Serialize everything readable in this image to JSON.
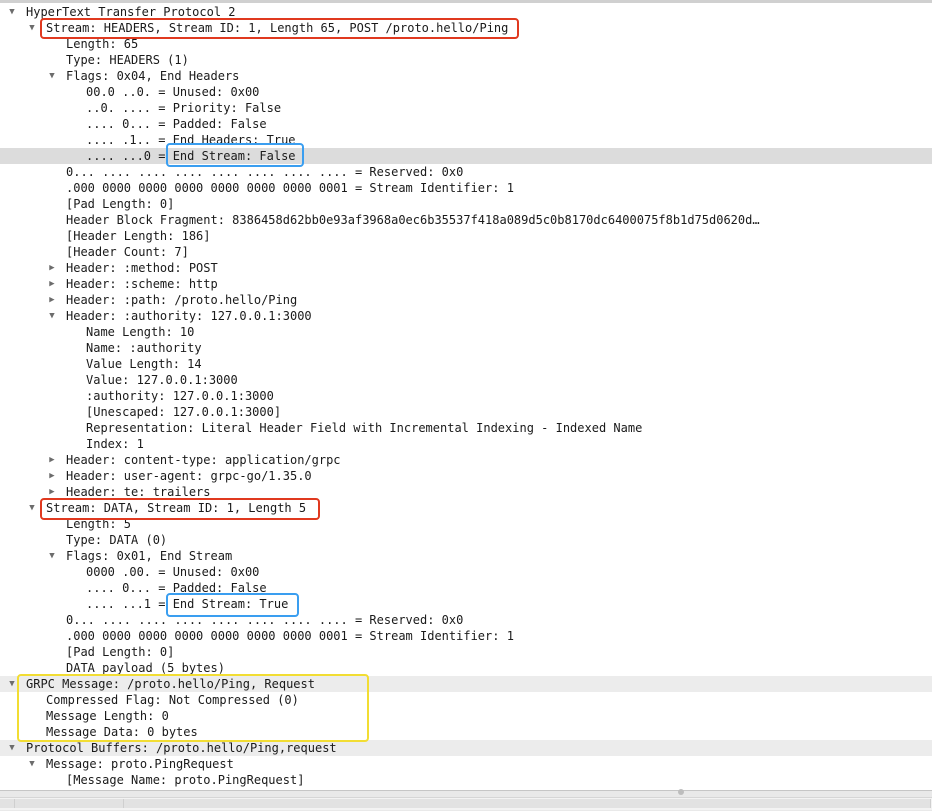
{
  "tree": [
    {
      "depth": 0,
      "toggle": "expanded",
      "text": "HyperText Transfer Protocol 2"
    },
    {
      "depth": 1,
      "toggle": "expanded",
      "text": "Stream: HEADERS, Stream ID: 1, Length 65, POST /proto.hello/Ping"
    },
    {
      "depth": 2,
      "toggle": "none",
      "text": "Length: 65"
    },
    {
      "depth": 2,
      "toggle": "none",
      "text": "Type: HEADERS (1)"
    },
    {
      "depth": 2,
      "toggle": "expanded",
      "text": "Flags: 0x04, End Headers"
    },
    {
      "depth": 3,
      "toggle": "none",
      "text": "00.0 ..0. = Unused: 0x00"
    },
    {
      "depth": 3,
      "toggle": "none",
      "text": "..0. .... = Priority: False"
    },
    {
      "depth": 3,
      "toggle": "none",
      "text": ".... 0... = Padded: False"
    },
    {
      "depth": 3,
      "toggle": "none",
      "text": ".... .1.. = End Headers: True"
    },
    {
      "depth": 3,
      "toggle": "none",
      "text": ".... ...0 = End Stream: False",
      "selected": true
    },
    {
      "depth": 2,
      "toggle": "none",
      "text": "0... .... .... .... .... .... .... .... = Reserved: 0x0"
    },
    {
      "depth": 2,
      "toggle": "none",
      "text": ".000 0000 0000 0000 0000 0000 0000 0001 = Stream Identifier: 1"
    },
    {
      "depth": 2,
      "toggle": "none",
      "text": "[Pad Length: 0]"
    },
    {
      "depth": 2,
      "toggle": "none",
      "text": "Header Block Fragment: 8386458d62bb0e93af3968a0ec6b35537f418a089d5c0b8170dc6400075f8b1d75d0620d…"
    },
    {
      "depth": 2,
      "toggle": "none",
      "text": "[Header Length: 186]"
    },
    {
      "depth": 2,
      "toggle": "none",
      "text": "[Header Count: 7]"
    },
    {
      "depth": 2,
      "toggle": "collapsed",
      "text": "Header: :method: POST"
    },
    {
      "depth": 2,
      "toggle": "collapsed",
      "text": "Header: :scheme: http"
    },
    {
      "depth": 2,
      "toggle": "collapsed",
      "text": "Header: :path: /proto.hello/Ping"
    },
    {
      "depth": 2,
      "toggle": "expanded",
      "text": "Header: :authority: 127.0.0.1:3000"
    },
    {
      "depth": 3,
      "toggle": "none",
      "text": "Name Length: 10"
    },
    {
      "depth": 3,
      "toggle": "none",
      "text": "Name: :authority"
    },
    {
      "depth": 3,
      "toggle": "none",
      "text": "Value Length: 14"
    },
    {
      "depth": 3,
      "toggle": "none",
      "text": "Value: 127.0.0.1:3000"
    },
    {
      "depth": 3,
      "toggle": "none",
      "text": ":authority: 127.0.0.1:3000"
    },
    {
      "depth": 3,
      "toggle": "none",
      "text": "[Unescaped: 127.0.0.1:3000]"
    },
    {
      "depth": 3,
      "toggle": "none",
      "text": "Representation: Literal Header Field with Incremental Indexing - Indexed Name"
    },
    {
      "depth": 3,
      "toggle": "none",
      "text": "Index: 1"
    },
    {
      "depth": 2,
      "toggle": "collapsed",
      "text": "Header: content-type: application/grpc"
    },
    {
      "depth": 2,
      "toggle": "collapsed",
      "text": "Header: user-agent: grpc-go/1.35.0"
    },
    {
      "depth": 2,
      "toggle": "collapsed",
      "text": "Header: te: trailers"
    },
    {
      "depth": 1,
      "toggle": "expanded",
      "text": "Stream: DATA, Stream ID: 1, Length 5"
    },
    {
      "depth": 2,
      "toggle": "none",
      "text": "Length: 5"
    },
    {
      "depth": 2,
      "toggle": "none",
      "text": "Type: DATA (0)"
    },
    {
      "depth": 2,
      "toggle": "expanded",
      "text": "Flags: 0x01, End Stream"
    },
    {
      "depth": 3,
      "toggle": "none",
      "text": "0000 .00. = Unused: 0x00"
    },
    {
      "depth": 3,
      "toggle": "none",
      "text": ".... 0... = Padded: False"
    },
    {
      "depth": 3,
      "toggle": "none",
      "text": ".... ...1 = End Stream: True"
    },
    {
      "depth": 2,
      "toggle": "none",
      "text": "0... .... .... .... .... .... .... .... = Reserved: 0x0"
    },
    {
      "depth": 2,
      "toggle": "none",
      "text": ".000 0000 0000 0000 0000 0000 0000 0001 = Stream Identifier: 1"
    },
    {
      "depth": 2,
      "toggle": "none",
      "text": "[Pad Length: 0]"
    },
    {
      "depth": 2,
      "toggle": "none",
      "text": "DATA payload (5 bytes)"
    },
    {
      "depth": 0,
      "toggle": "expanded",
      "text": "GRPC Message: /proto.hello/Ping, Request",
      "section": true
    },
    {
      "depth": 1,
      "toggle": "none",
      "text": "Compressed Flag: Not Compressed (0)"
    },
    {
      "depth": 1,
      "toggle": "none",
      "text": "Message Length: 0"
    },
    {
      "depth": 1,
      "toggle": "none",
      "text": "Message Data: 0 bytes"
    },
    {
      "depth": 0,
      "toggle": "expanded",
      "text": "Protocol Buffers: /proto.hello/Ping,request",
      "section": true
    },
    {
      "depth": 1,
      "toggle": "expanded",
      "text": "Message: proto.PingRequest"
    },
    {
      "depth": 2,
      "toggle": "none",
      "text": "[Message Name: proto.PingRequest]"
    }
  ],
  "colors": {
    "highlight_red": "#e0391f",
    "highlight_blue": "#3a9ef0",
    "highlight_yellow": "#f2dd33",
    "selected_row": "#dcdcdc"
  }
}
